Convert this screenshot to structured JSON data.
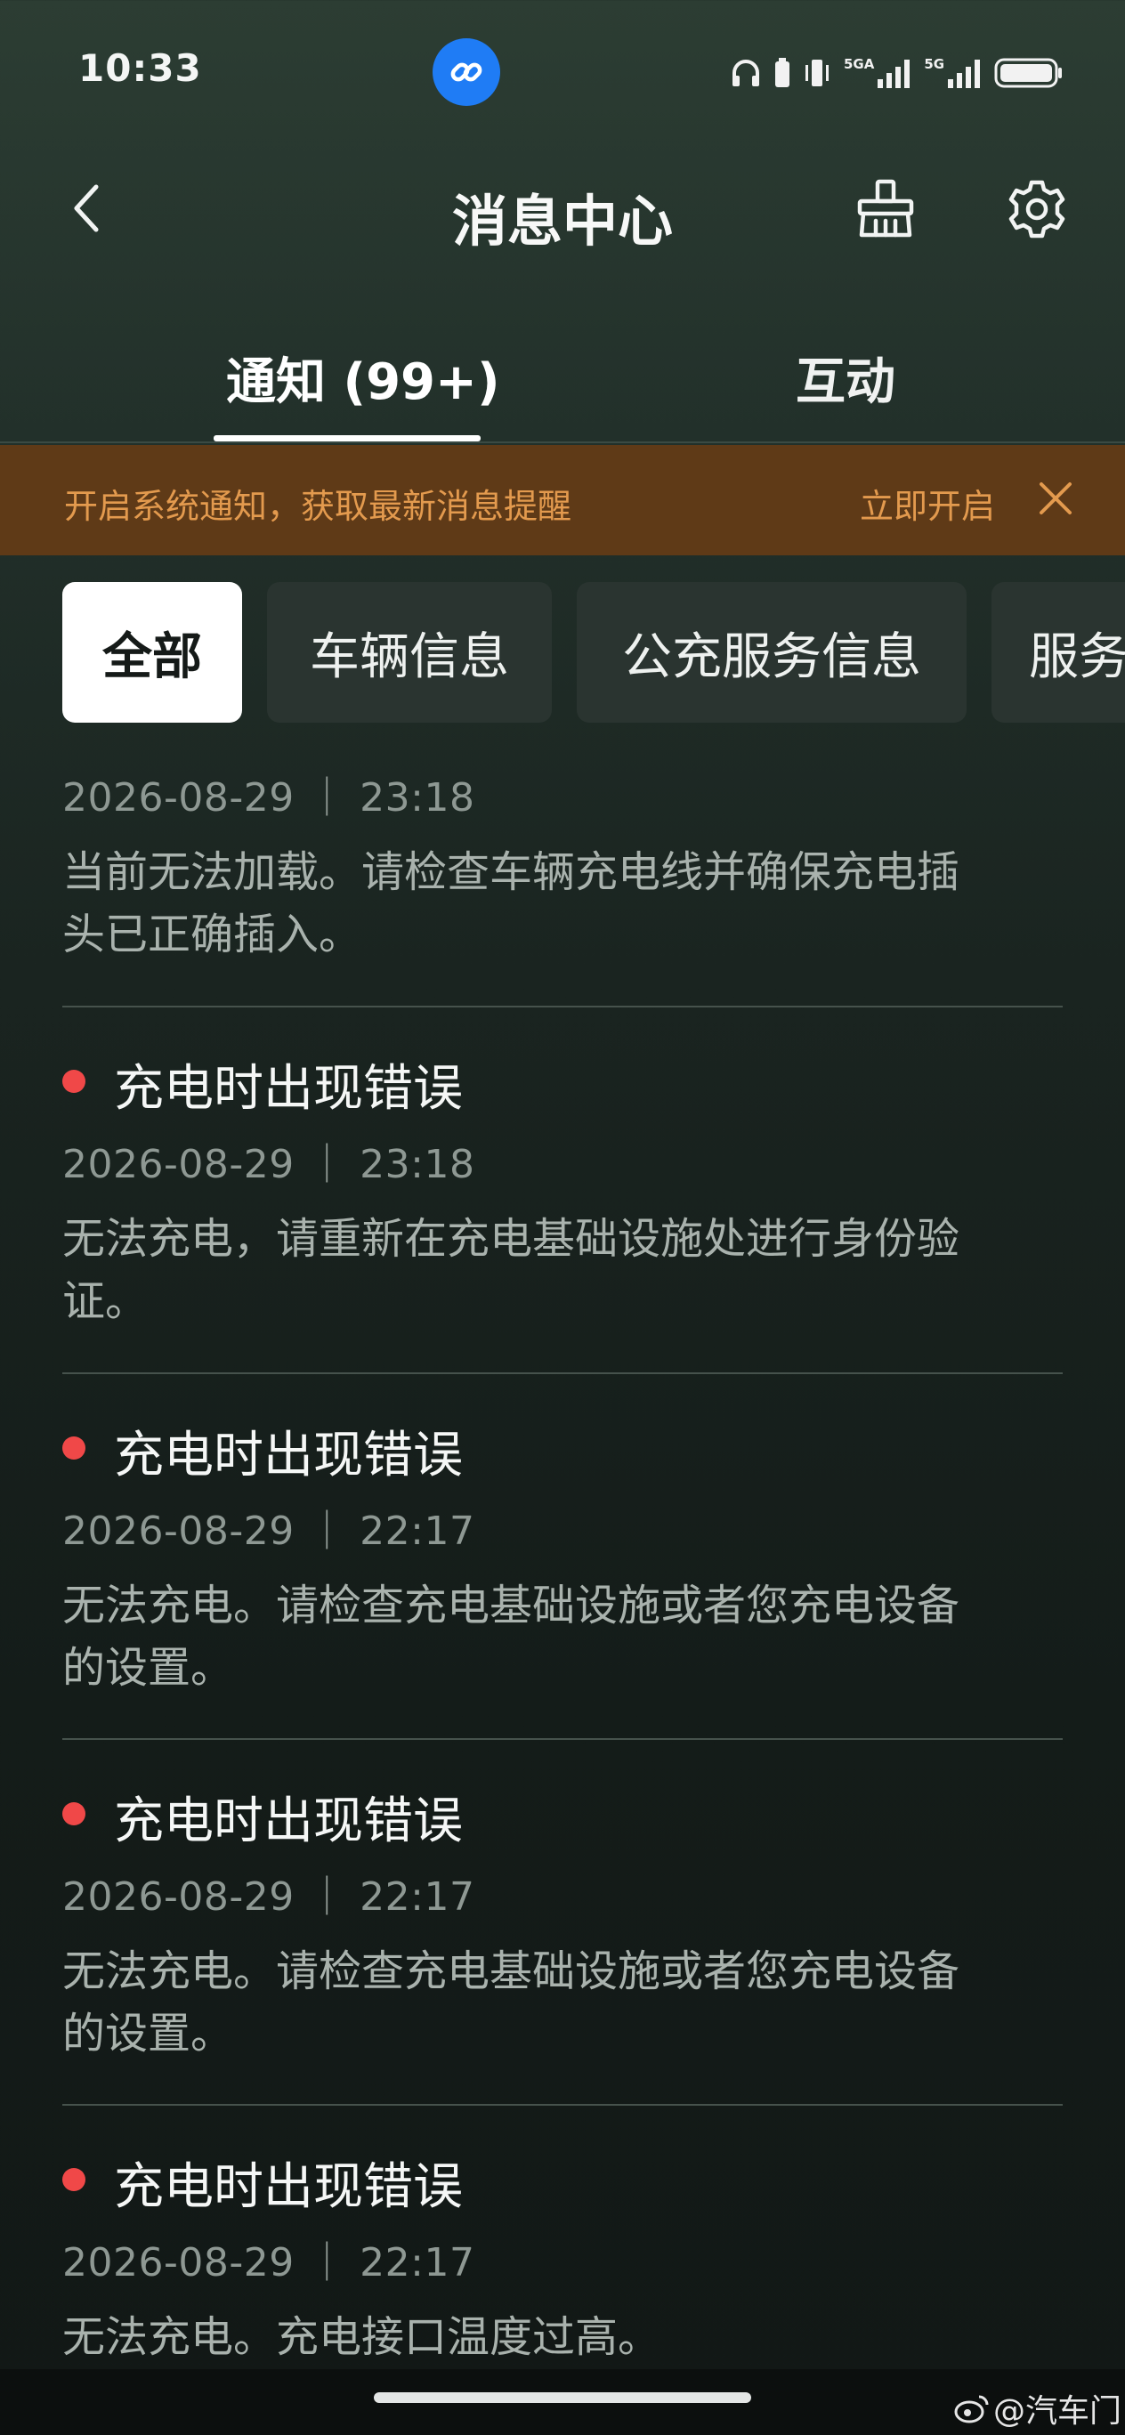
{
  "status_bar": {
    "time": "10:33",
    "network_1": "5GA",
    "network_2": "5G",
    "icons": [
      "link-icon",
      "headphones-icon",
      "vibrate-icon",
      "signal-icon",
      "battery-icon"
    ]
  },
  "header": {
    "title": "消息中心",
    "icons": [
      "back-icon",
      "clean-icon",
      "gear-icon"
    ]
  },
  "tabs": [
    {
      "label": "通知 (99+)",
      "active": true
    },
    {
      "label": "互动",
      "active": false
    }
  ],
  "banner": {
    "text": "开启系统通知，获取最新消息提醒",
    "action": "立即开启",
    "color": "#e39a4e",
    "background": "#5f3a17"
  },
  "filters": [
    {
      "label": "全部",
      "active": true
    },
    {
      "label": "车辆信息",
      "active": false
    },
    {
      "label": "公充服务信息",
      "active": false
    },
    {
      "label": "服务",
      "active": false
    }
  ],
  "messages": [
    {
      "title": "",
      "unread": false,
      "time": "2026-08-29 ｜ 23:18",
      "lines": [
        "当前无法加载。请检查车辆充电线并确保充电插",
        "头已正确插入。"
      ]
    },
    {
      "title": "充电时出现错误",
      "unread": true,
      "time": "2026-08-29 ｜ 23:18",
      "lines": [
        "无法充电，请重新在充电基础设施处进行身份验",
        "证。"
      ]
    },
    {
      "title": "充电时出现错误",
      "unread": true,
      "time": "2026-08-29 ｜ 22:17",
      "lines": [
        "无法充电。请检查充电基础设施或者您充电设备",
        "的设置。"
      ]
    },
    {
      "title": "充电时出现错误",
      "unread": true,
      "time": "2026-08-29 ｜ 22:17",
      "lines": [
        "无法充电。请检查充电基础设施或者您充电设备",
        "的设置。"
      ]
    },
    {
      "title": "充电时出现错误",
      "unread": true,
      "time": "2026-08-29 ｜ 22:17",
      "lines": [
        "无法充电。充电接口温度过高。"
      ]
    }
  ],
  "watermark": "@汽车门",
  "colors": {
    "unread_dot": "#f04848",
    "active_chip": "#ffffff"
  }
}
